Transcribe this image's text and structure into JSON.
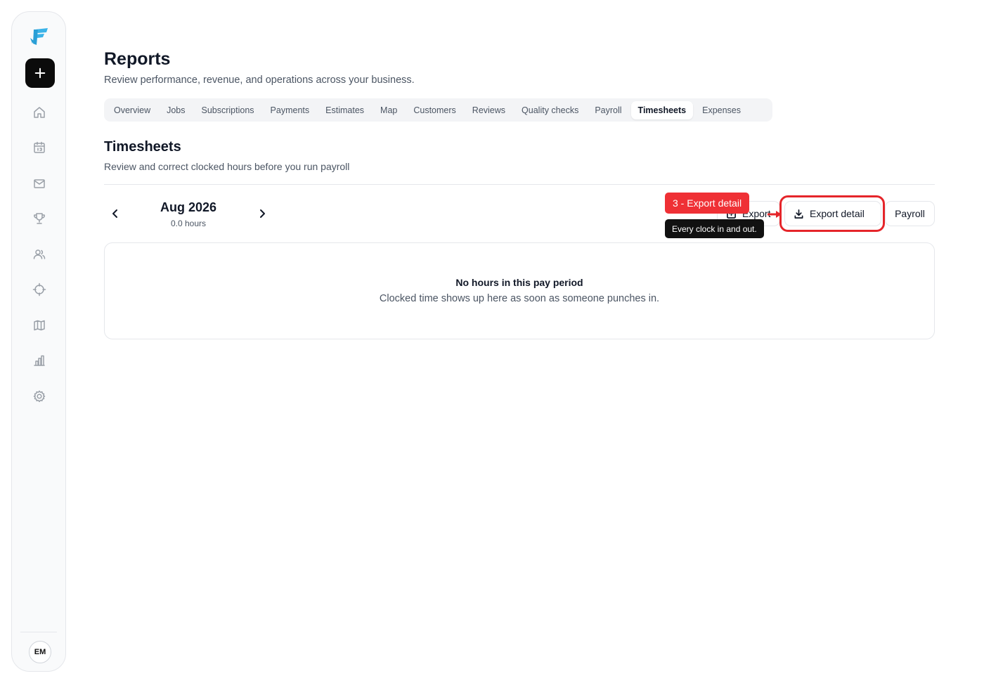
{
  "sidebar": {
    "add_label": "+",
    "avatar_initials": "EM",
    "icons": [
      "home-icon",
      "calendar-icon",
      "mail-icon",
      "trophy-icon",
      "users-icon",
      "crosshair-icon",
      "map-icon",
      "chart-icon",
      "gear-icon"
    ]
  },
  "header": {
    "title": "Reports",
    "subtitle": "Review performance, revenue, and operations across your business."
  },
  "tabs": [
    {
      "label": "Overview",
      "active": false
    },
    {
      "label": "Jobs",
      "active": false
    },
    {
      "label": "Subscriptions",
      "active": false
    },
    {
      "label": "Payments",
      "active": false
    },
    {
      "label": "Estimates",
      "active": false
    },
    {
      "label": "Map",
      "active": false
    },
    {
      "label": "Customers",
      "active": false
    },
    {
      "label": "Reviews",
      "active": false
    },
    {
      "label": "Quality checks",
      "active": false
    },
    {
      "label": "Payroll",
      "active": false
    },
    {
      "label": "Timesheets",
      "active": true
    },
    {
      "label": "Expenses",
      "active": false
    }
  ],
  "section": {
    "title": "Timesheets",
    "subtitle": "Review and correct clocked hours before you run payroll"
  },
  "period": {
    "label": "Aug 2026",
    "hours": "0.0 hours"
  },
  "actions": {
    "export_label": "Export",
    "export_detail_label": "Export detail",
    "payroll_label": "Payroll"
  },
  "annotation": {
    "callout": "3 - Export detail",
    "tooltip": "Every clock in and out.",
    "color": "#e5252a"
  },
  "empty_state": {
    "title": "No hours in this pay period",
    "text": "Clocked time shows up here as soon as someone punches in."
  },
  "colors": {
    "logo": "#3bb3e8",
    "primary_button": "#0b0b0b"
  }
}
